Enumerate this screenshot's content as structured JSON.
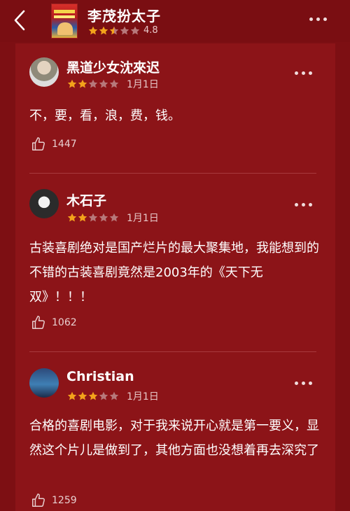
{
  "header": {
    "title": "李茂扮太子",
    "rating": "4.8",
    "stars_filled": 2.5
  },
  "reviews": [
    {
      "username": "黑道少女沈來迟",
      "stars": 2,
      "date": "1月1日",
      "text": "不，要，看，浪，费，钱。",
      "likes": "1447"
    },
    {
      "username": "木石子",
      "stars": 2,
      "date": "1月1日",
      "text": "古装喜剧绝对是国产烂片的最大聚集地，我能想到的不错的古装喜剧竟然是2003年的《天下无双》！！！",
      "likes": "1062"
    },
    {
      "username": "Christian",
      "stars": 3,
      "date": "1月1日",
      "text": "合格的喜剧电影，对于我来说开心就是第一要义，显然这个片儿是做到了，其他方面也没想着再去深究了",
      "likes": "1259"
    }
  ],
  "colors": {
    "background": "#7d0f13",
    "card": "#8c1418",
    "star_filled": "#f3a21b",
    "star_empty": "#b7787a"
  }
}
